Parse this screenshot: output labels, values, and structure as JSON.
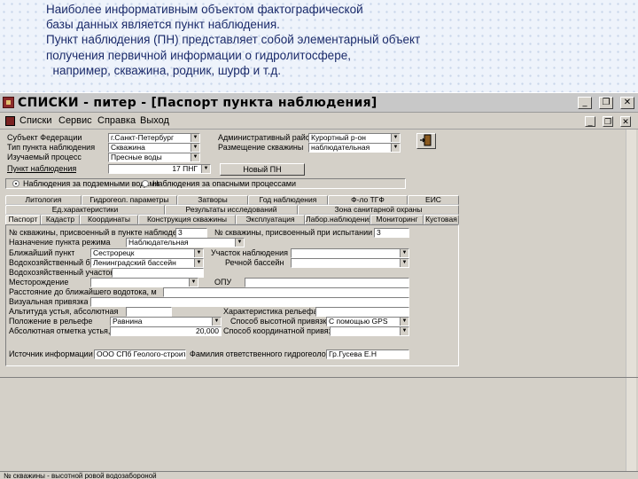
{
  "slide": {
    "lines": [
      "Наиболее информативным объектом фактографической",
      "базы данных является пункт наблюдения.",
      "Пункт наблюдения (ПН) представляет собой элементарный объект",
      "получения первичной информации о гидролитосфере,",
      "  например, скважина, родник, шурф и т.д."
    ]
  },
  "window": {
    "title": "СПИСКИ - питер - [Паспорт пункта наблюдения]",
    "minimize": "_",
    "restore": "❐",
    "close": "✕"
  },
  "menu": {
    "items": [
      "Списки",
      "Сервис",
      "Справка",
      "Выход"
    ],
    "inner_min": "_",
    "inner_restore": "❐",
    "inner_close": "✕"
  },
  "header": {
    "subject_label": "Субъект Федерации",
    "subject_value": "г.Санкт-Петербург",
    "obs_type_label": "Тип пункта наблюдения",
    "obs_type_value": "Скважина",
    "aquifer_label": "Изучаемый процесс",
    "aquifer_value": "Пресные воды",
    "admin_label": "Административный район",
    "admin_value": "Курортный р-он",
    "place_label": "Размещение скважины",
    "place_value": "наблюдательная",
    "pn_label": "Пункт наблюдения",
    "pn_value": "17 ПНГ",
    "new_pn": "Новый ПН",
    "radio1": "Наблюдения за подземными водами",
    "radio2": "Наблюдения за опасными процессами"
  },
  "tabs_top": [
    "Литология",
    "Гидрогеол. параметры",
    "Затворы",
    "Год наблюдения",
    "Ф-ло ТГФ",
    "ЕИС"
  ],
  "tabs_mid": [
    "Ед.характеристики",
    "Результаты исследований",
    "Зона санитарной охраны"
  ],
  "tabs_bottom": [
    "Паспорт",
    "Кадастр",
    "Координаты",
    "Конструкция скважины",
    "Эксплуатация",
    "Лабор.наблюдения",
    "Мониторинг",
    "Кустовая"
  ],
  "form": {
    "num_pn_label": "№ скважины, присвоенный в пункте наблюдения",
    "num_pn_value": "3",
    "num_pr_label": "№ скважины, присвоенный при испытании",
    "num_pr_value": "3",
    "level_label": "Назначение пункта режима",
    "level_value": "Наблюдательная",
    "river_label": "Ближайший пункт",
    "river_value": "Сестрорецк",
    "stream_label": "Участок наблюдения",
    "stream_value": "",
    "basin_label": "Водохозяйственный бассейн",
    "basin_value": "Ленинградский бассейн",
    "basin2_label": "Речной бассейн",
    "basin2_value": "",
    "wh_label": "Водохозяйственный участок",
    "wh_value": "",
    "place_label": "Месторождение",
    "place_value": "",
    "opu_label": "ОПУ",
    "opu_value": "",
    "dist_label": "Расстояние до ближайшего водотока, м",
    "dist_value": "",
    "geo_label": "Визуальная привязка",
    "geo_value": "",
    "height_label": "Альтитуда устья, абсолютная",
    "height_value": "",
    "height_label2": "Характеристика рельефа",
    "height_value2": "",
    "relief_label": "Положение в рельефе",
    "relief_value": "Равнина",
    "relief_method_label": "Способ высотной привязки",
    "relief_method_value": "С помощью GPS",
    "alt_label": "Абсолютная отметка устья, м",
    "alt_value": "20,000",
    "coord_method_label": "Способ координатной привязки",
    "coord_method_value": "",
    "source_label": "Источник информации",
    "source_value": "ООО СПб Геолого-строит.",
    "author_label": "Фамилия ответственного гидрогеолога",
    "author_value": "Гр.Гусева Е.Н"
  },
  "status": {
    "text": "№ скважины - высотной ровой водозабороной"
  }
}
